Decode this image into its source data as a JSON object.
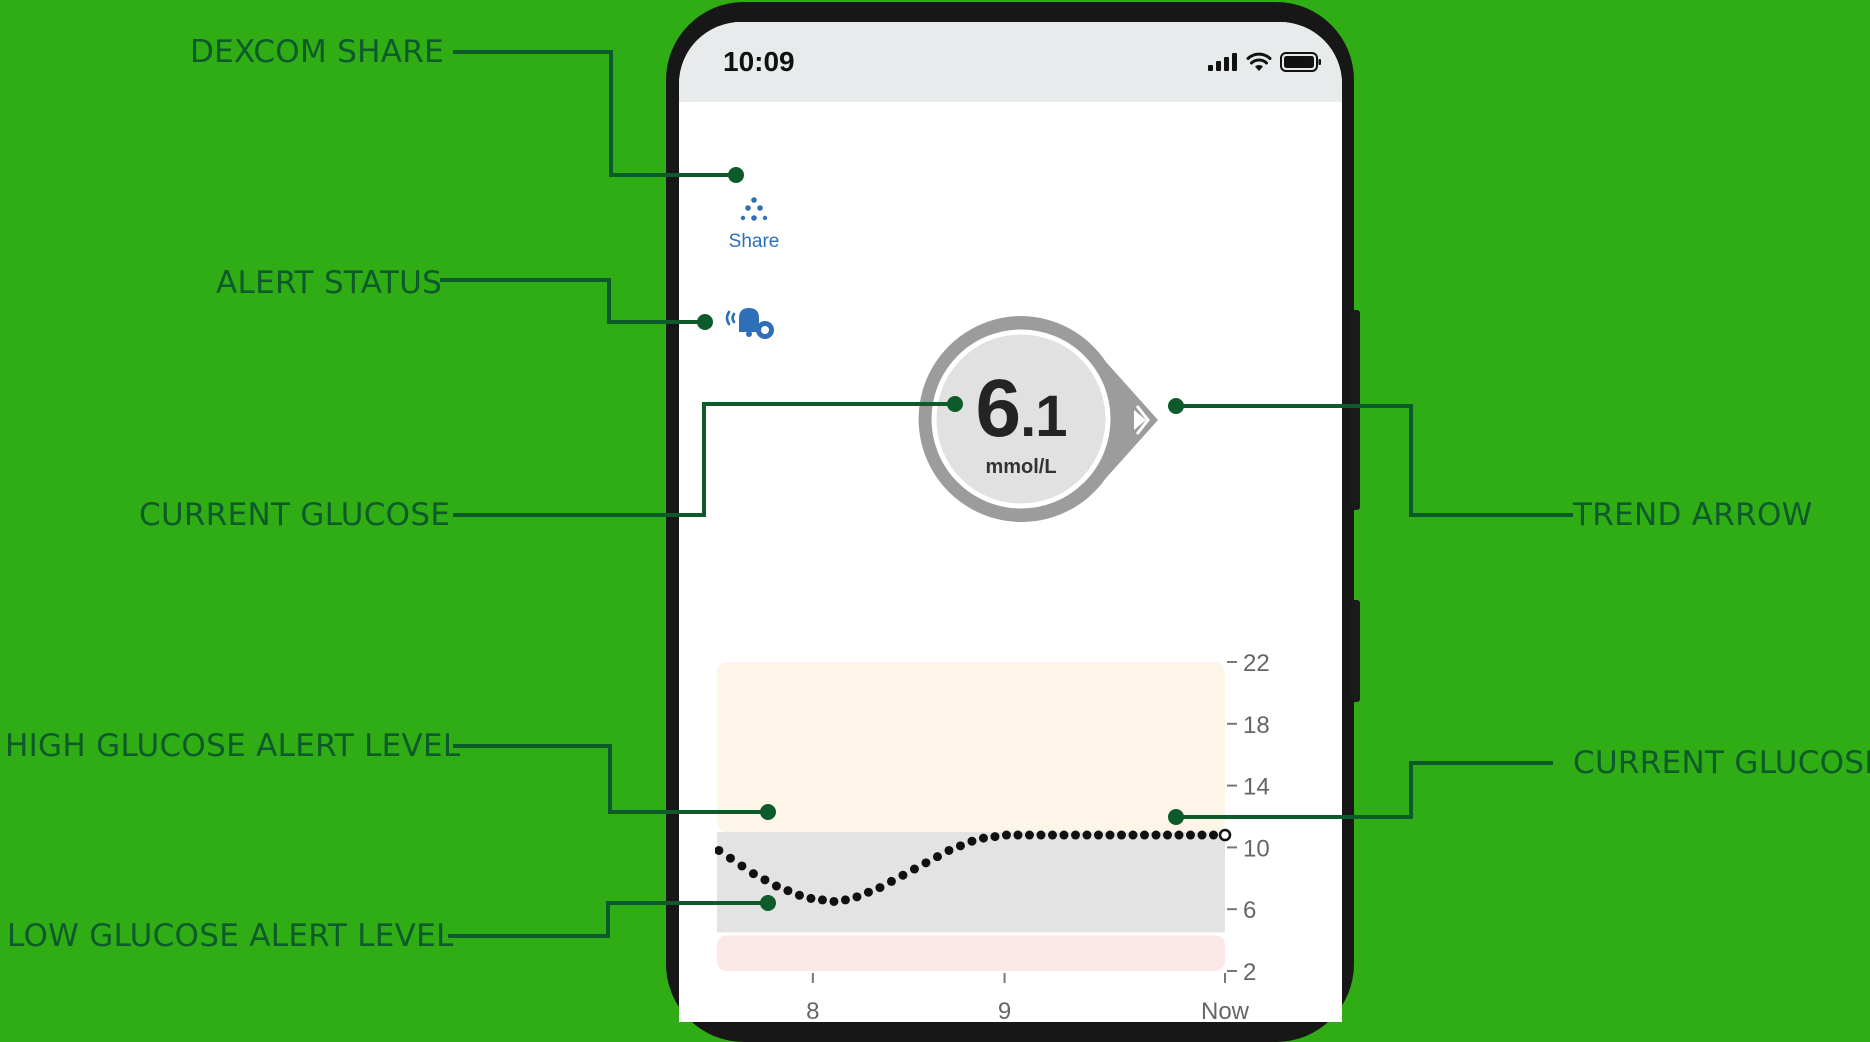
{
  "callouts": {
    "dexcom_share": "DEXCOM SHARE",
    "alert_status": "ALERT STATUS",
    "current_glucose_left": "CURRENT GLUCOSE",
    "trend_arrow": "TREND ARROW",
    "high_alert": "HIGH GLUCOSE ALERT LEVEL",
    "current_glucose_right": "CURRENT GLUCOSE",
    "low_alert": "LOW GLUCOSE ALERT LEVEL"
  },
  "status_bar": {
    "time": "10:09"
  },
  "share": {
    "label": "Share"
  },
  "glucose": {
    "whole": "6",
    "decimal": ".1",
    "unit": "mmol/L"
  },
  "colors": {
    "background": "#30ad14",
    "callout_text": "#0d5a2a",
    "share_blue": "#2e6fb8",
    "high_zone": "#fdf6e8",
    "target_zone": "#e3e3e3",
    "low_zone": "#fce8e8"
  },
  "chart_data": {
    "type": "scatter",
    "x_tick_labels": [
      "8",
      "9",
      "Now"
    ],
    "y_ticks": [
      22,
      18,
      14,
      10,
      6,
      2
    ],
    "ylim": [
      2,
      22
    ],
    "xlim": [
      7.5,
      10.15
    ],
    "high_alert_level": 11,
    "low_alert_level": 4.5,
    "series": [
      {
        "x": [
          7.51,
          7.57,
          7.63,
          7.69,
          7.75,
          7.81,
          7.87,
          7.93,
          7.99,
          8.05,
          8.11,
          8.17,
          8.23,
          8.29,
          8.35,
          8.41,
          8.47,
          8.53,
          8.59,
          8.65,
          8.71,
          8.77,
          8.83,
          8.89,
          8.95,
          9.01,
          9.07,
          9.13,
          9.19,
          9.25,
          9.31,
          9.37,
          9.43,
          9.49,
          9.55,
          9.61,
          9.67,
          9.73,
          9.79,
          9.85,
          9.91,
          9.97,
          10.03,
          10.09,
          10.15
        ],
        "y": [
          9.8,
          9.3,
          8.8,
          8.3,
          7.9,
          7.5,
          7.2,
          6.9,
          6.7,
          6.6,
          6.5,
          6.6,
          6.8,
          7.1,
          7.4,
          7.8,
          8.2,
          8.6,
          9.0,
          9.4,
          9.8,
          10.1,
          10.4,
          10.6,
          10.7,
          10.8,
          10.8,
          10.8,
          10.8,
          10.8,
          10.8,
          10.8,
          10.8,
          10.8,
          10.8,
          10.8,
          10.8,
          10.8,
          10.8,
          10.8,
          10.8,
          10.8,
          10.8,
          10.8,
          10.8
        ]
      }
    ]
  }
}
